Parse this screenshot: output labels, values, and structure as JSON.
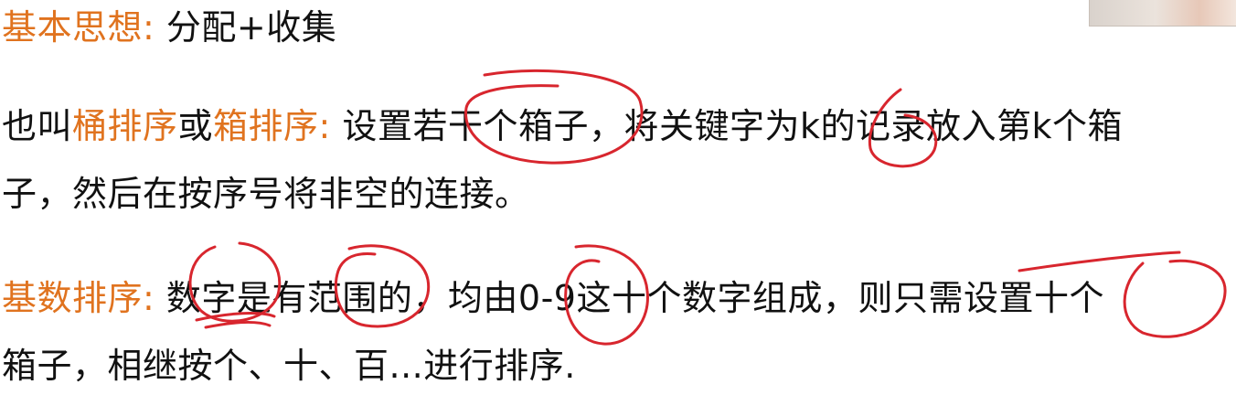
{
  "line1": {
    "label": "基本思想:",
    "text": "分配+收集"
  },
  "line2": {
    "t1": "也叫",
    "h1": "桶排序",
    "t2": "或",
    "h2": "箱排序:",
    "t3": "设置若干个箱子，将关键字为k的记录放入第k个箱"
  },
  "line3": {
    "text": "子，然后在按序号将非空的连接。"
  },
  "line4": {
    "label": "基数排序:",
    "text": "数字是有范围的，均由0-9这十个数字组成，则只需设置十个"
  },
  "line5": {
    "text": "箱子，相继按个、十、百...进行排序."
  },
  "colors": {
    "accent": "#e0731f",
    "ink": "#d8262e",
    "text": "#111111"
  }
}
